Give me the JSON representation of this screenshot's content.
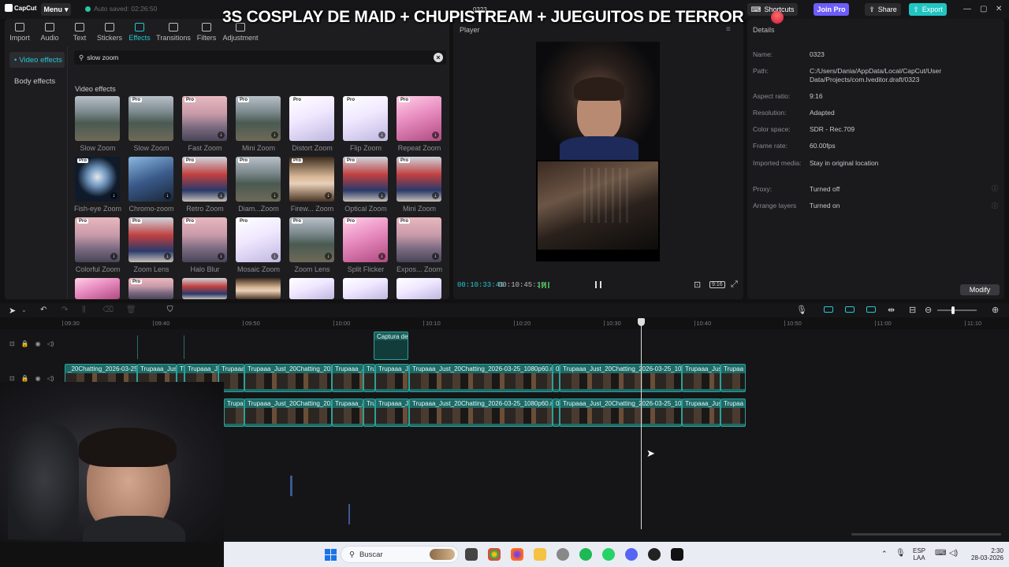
{
  "app": {
    "logo_text": "CapCut",
    "menu_label": "Menu",
    "autosave": "Auto saved: 02:26:50",
    "project_name": "0323",
    "stream_title": "3S COSPLAY DE MAID + CHUPISTREAM + JUEGUITOS DE TERROR",
    "shortcuts_label": "Shortcuts",
    "joinpro_label": "Join Pro",
    "share_label": "Share",
    "export_label": "Export"
  },
  "tool_tabs": [
    {
      "label": "Import",
      "icon": "import-icon"
    },
    {
      "label": "Audio",
      "icon": "audio-icon"
    },
    {
      "label": "Text",
      "icon": "text-icon"
    },
    {
      "label": "Stickers",
      "icon": "stickers-icon"
    },
    {
      "label": "Effects",
      "icon": "effects-icon",
      "active": true
    },
    {
      "label": "Transitions",
      "icon": "transitions-icon"
    },
    {
      "label": "Filters",
      "icon": "filters-icon"
    },
    {
      "label": "Adjustment",
      "icon": "adjustment-icon"
    }
  ],
  "categories": [
    "Video effects",
    "Body effects"
  ],
  "search": {
    "value": "slow zoom"
  },
  "section_label": "Video effects",
  "effects": [
    {
      "name": "Slow Zoom",
      "thumb": "forest",
      "pro": false,
      "dl": false
    },
    {
      "name": "Slow Zoom",
      "thumb": "forest",
      "pro": true,
      "dl": false
    },
    {
      "name": "Fast Zoom",
      "thumb": "city",
      "pro": true,
      "dl": true
    },
    {
      "name": "Mini Zoom",
      "thumb": "forest",
      "pro": true,
      "dl": true
    },
    {
      "name": "Distort Zoom",
      "thumb": "glow",
      "pro": true,
      "dl": false
    },
    {
      "name": "Flip Zoom",
      "thumb": "glow",
      "pro": true,
      "dl": true
    },
    {
      "name": "Repeat Zoom",
      "thumb": "pink",
      "pro": true,
      "dl": true
    },
    {
      "name": "Fish-eye Zoom",
      "thumb": "dark",
      "pro": true,
      "dl": true
    },
    {
      "name": "Chromo-zoom",
      "thumb": "blue",
      "pro": false,
      "dl": true
    },
    {
      "name": "Retro Zoom",
      "thumb": "red",
      "pro": true,
      "dl": true
    },
    {
      "name": "Diam...Zoom",
      "thumb": "forest",
      "pro": true,
      "dl": true
    },
    {
      "name": "Firew... Zoom",
      "thumb": "warm",
      "pro": true,
      "dl": true
    },
    {
      "name": "Optical Zoom",
      "thumb": "red",
      "pro": true,
      "dl": true
    },
    {
      "name": "Mini Zoom",
      "thumb": "red",
      "pro": true,
      "dl": true
    },
    {
      "name": "Colorful Zoom",
      "thumb": "city",
      "pro": true,
      "dl": true
    },
    {
      "name": "Zoom Lens",
      "thumb": "red",
      "pro": true,
      "dl": true
    },
    {
      "name": "Halo Blur",
      "thumb": "city",
      "pro": true,
      "dl": true
    },
    {
      "name": "Mosaic Zoom",
      "thumb": "glow",
      "pro": true,
      "dl": true
    },
    {
      "name": "Zoom Lens",
      "thumb": "forest",
      "pro": true,
      "dl": true
    },
    {
      "name": "Split Flicker",
      "thumb": "pink",
      "pro": true,
      "dl": true
    },
    {
      "name": "Expos... Zoom",
      "thumb": "city",
      "pro": true,
      "dl": true
    },
    {
      "name": "",
      "thumb": "pink",
      "pro": false,
      "dl": false
    },
    {
      "name": "",
      "thumb": "city",
      "pro": true,
      "dl": false
    },
    {
      "name": "",
      "thumb": "red",
      "pro": false,
      "dl": false
    },
    {
      "name": "",
      "thumb": "warm",
      "pro": false,
      "dl": false
    },
    {
      "name": "",
      "thumb": "glow",
      "pro": false,
      "dl": false
    },
    {
      "name": "",
      "thumb": "glow",
      "pro": false,
      "dl": false
    },
    {
      "name": "",
      "thumb": "glow",
      "pro": false,
      "dl": false
    }
  ],
  "player": {
    "label": "Player",
    "current_time": "00:10:33:41",
    "total_time": "00:10:45:19",
    "ratio_label": "9:16"
  },
  "details": {
    "header": "Details",
    "rows": [
      {
        "k": "Name:",
        "v": "0323"
      },
      {
        "k": "Path:",
        "v": "C:/Users/Dania/AppData/Local/CapCut/User Data/Projects/com.lveditor.draft/0323"
      },
      {
        "k": "Aspect ratio:",
        "v": "9:16"
      },
      {
        "k": "Resolution:",
        "v": "Adapted"
      },
      {
        "k": "Color space:",
        "v": "SDR - Rec.709"
      },
      {
        "k": "Frame rate:",
        "v": "60.00fps"
      },
      {
        "k": "Imported media:",
        "v": "Stay in original location"
      },
      {
        "k": "Proxy:",
        "v": "Turned off"
      },
      {
        "k": "Arrange layers",
        "v": "Turned on"
      }
    ],
    "modify_label": "Modify"
  },
  "timeline": {
    "ticks": [
      "09:30",
      "09:40",
      "09:50",
      "10:00",
      "10:10",
      "10:20",
      "10:30",
      "10:40",
      "10:50",
      "11:00",
      "11:10"
    ],
    "text_clip_label": "Captura de",
    "clip_labels_row1": [
      "_20Chatting_2026-03-25_1(",
      "Trupaaa_Just",
      "Tr",
      "Trupaaa_J",
      "Trupaaa_",
      "Trupaaa_Just_20Chatting_2026-",
      "Trupaaa_Ju",
      "Tru",
      "Trupaaa_Ju",
      "Trupaaa_Just_20Chatting_2026-03-25_1080p60.mp4",
      "0(",
      "Trupaaa_Just_20Chatting_2026-03-25_1080p",
      "Trupaaa_Just",
      "Trupaa"
    ],
    "clip_labels_row2": [
      "Trupaaa_",
      "Trupaaa_Just_20Chatting_2026-",
      "Trupaaa_Ju",
      "Tru",
      "Trupaaa_Ju",
      "Trupaaa_Just_20Chatting_2026-03-25_1080p60.mp4",
      "0(",
      "Trupaaa_Just_20Chatting_2026-03-25_1080p",
      "Trupaaa_Just",
      "Trupaa"
    ]
  },
  "taskbar": {
    "search_label": "Buscar",
    "lang_top": "ESP",
    "lang_bottom": "LAA",
    "time": "2:30",
    "date": "28-03-2026"
  },
  "colors": {
    "accent": "#22c9d1",
    "export": "#20c5c3",
    "join_pro": "#6d5dfc",
    "clip": "#1d6a66"
  }
}
